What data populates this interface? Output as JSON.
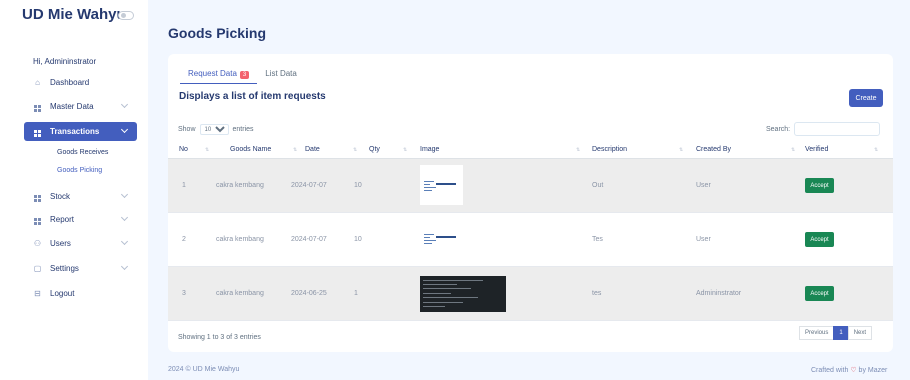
{
  "app": {
    "brand": "UD Mie Wahyu"
  },
  "sidebar": {
    "greeting": "Hi, Admininstrator",
    "items": [
      {
        "label": "Dashboard",
        "icon": "home-icon"
      },
      {
        "label": "Master Data",
        "icon": "grid-icon"
      },
      {
        "label": "Transactions",
        "icon": "grid-icon",
        "active": true
      },
      {
        "label": "Stock",
        "icon": "grid-icon"
      },
      {
        "label": "Report",
        "icon": "grid-icon"
      },
      {
        "label": "Users",
        "icon": "users-icon"
      },
      {
        "label": "Settings",
        "icon": "settings-icon"
      },
      {
        "label": "Logout",
        "icon": "logout-icon"
      }
    ],
    "submenu": [
      "Goods Receives",
      "Goods Picking"
    ]
  },
  "page": {
    "title": "Goods Picking"
  },
  "card": {
    "tabs": [
      {
        "label": "Request Data",
        "badge": "3"
      },
      {
        "label": "List Data"
      }
    ],
    "title": "Displays a list of item requests",
    "create_label": "Create",
    "show_label": "Show",
    "entries_value": "10",
    "entries_label": "entries",
    "search_label": "Search:"
  },
  "table": {
    "columns": [
      "No",
      "Goods Name",
      "Date",
      "Qty",
      "Image",
      "Description",
      "Created By",
      "Verified"
    ],
    "rows": [
      {
        "no": "1",
        "name": "cakra kembang",
        "date": "2024-07-07",
        "qty": "10",
        "description": "Out",
        "created_by": "User",
        "verified": "Accept"
      },
      {
        "no": "2",
        "name": "cakra kembang",
        "date": "2024-07-07",
        "qty": "10",
        "description": "Tes",
        "created_by": "User",
        "verified": "Accept"
      },
      {
        "no": "3",
        "name": "cakra kembang",
        "date": "2024-06-25",
        "qty": "1",
        "description": "tes",
        "created_by": "Admininstrator",
        "verified": "Accept"
      }
    ],
    "info": "Showing 1 to 3 of 3 entries",
    "pagination": {
      "previous": "Previous",
      "current": "1",
      "next": "Next"
    }
  },
  "footer": {
    "copyright": "2024 © UD Mie Wahyu",
    "crafted_prefix": "Crafted with",
    "crafted_suffix": "by Mazer"
  },
  "colors": {
    "primary": "#435ebe",
    "success": "#198754",
    "badge": "#f3616d",
    "background": "#f2f7ff"
  }
}
